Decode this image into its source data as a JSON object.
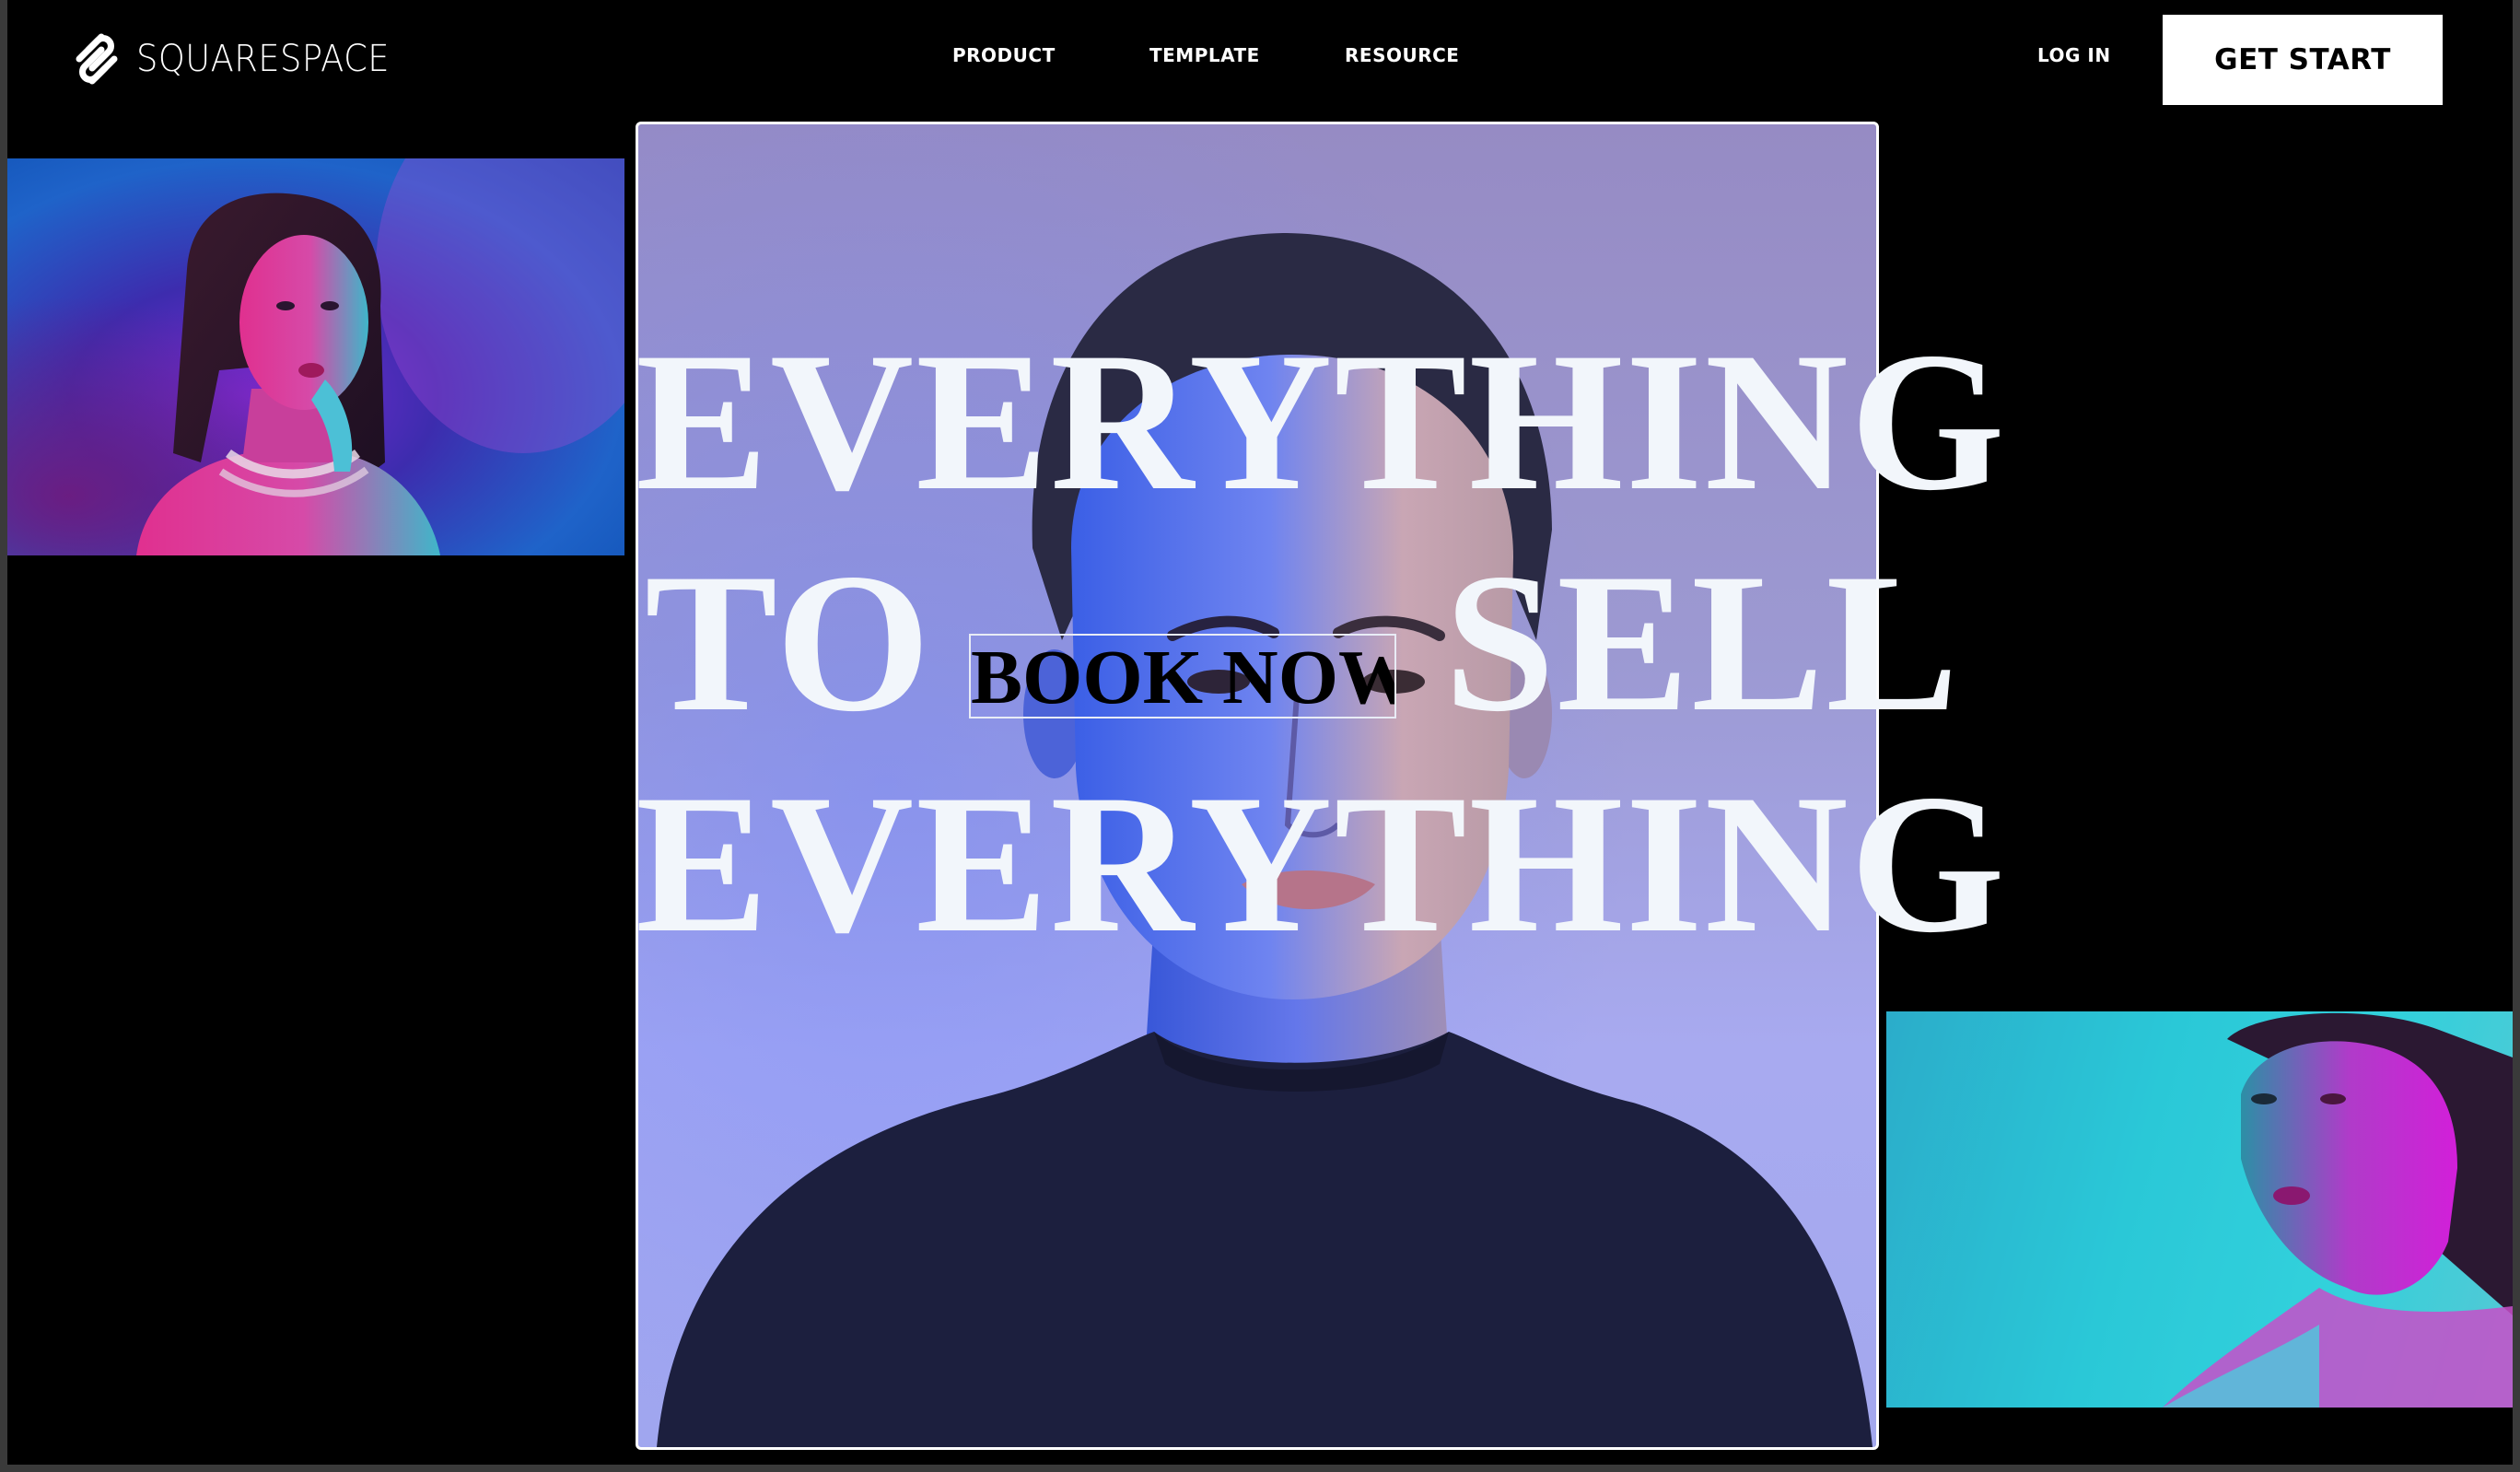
{
  "brand": {
    "name": "SQUARESPACE",
    "logo_icon": "squarespace-logo-icon"
  },
  "nav": {
    "links": [
      {
        "label": "PRODUCT"
      },
      {
        "label": "TEMPLATE"
      },
      {
        "label": "RESOURCE"
      }
    ],
    "login_label": "LOG IN",
    "cta_label": "GET START"
  },
  "hero": {
    "line1": "EVERYTHING",
    "line2_left": "TO",
    "line2_right": "SELL",
    "line3": "EVERYTHING",
    "book_label": "BOOK NOW"
  },
  "colors": {
    "background": "#000000",
    "hero_text": "#f2f6fb",
    "cta_background": "#ffffff",
    "cta_text": "#000000"
  }
}
